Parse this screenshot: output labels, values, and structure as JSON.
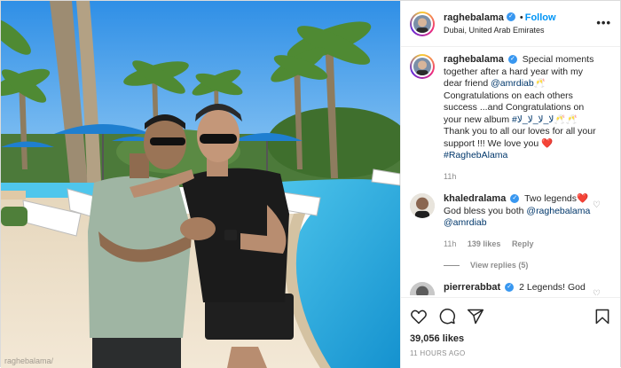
{
  "post": {
    "username": "raghebalama",
    "follow_label": "Follow",
    "location": "Dubai, United Arab Emirates",
    "more_label": "•••",
    "photo_credit": "raghebalama/",
    "caption": {
      "username": "raghebalama",
      "text_1": "Special moments together after a hard year with my dear friend ",
      "mention": "@amrdiab",
      "text_2": "🥂 Congratulations on each others success ...and Congratulations on your new album ",
      "hashtag_1": "#ﻻ_ﻻ_ﻻ_ﻻ",
      "text_3": "🥂🥂 Thank you to all our loves for all your support !!! We love you ❤️ ",
      "hashtag_2": "#RaghebAlama",
      "time": "11h"
    },
    "comments": [
      {
        "username": "khaledralama",
        "text": "Two legends❤️ God bless you both ",
        "mention_1": "@raghebalama",
        "mention_2": "@amrdiab",
        "time": "11h",
        "likes": "139 likes",
        "reply": "Reply",
        "view_replies": "View replies (5)"
      },
      {
        "username": "pierrerabbat",
        "text": "2 Legends! God"
      }
    ],
    "icons": {
      "like": "heart-icon",
      "comment": "comment-icon",
      "share": "share-icon",
      "save": "bookmark-icon"
    },
    "likes": "39,056 likes",
    "timestamp": "11 HOURS AGO",
    "accent": "#0095f6"
  }
}
